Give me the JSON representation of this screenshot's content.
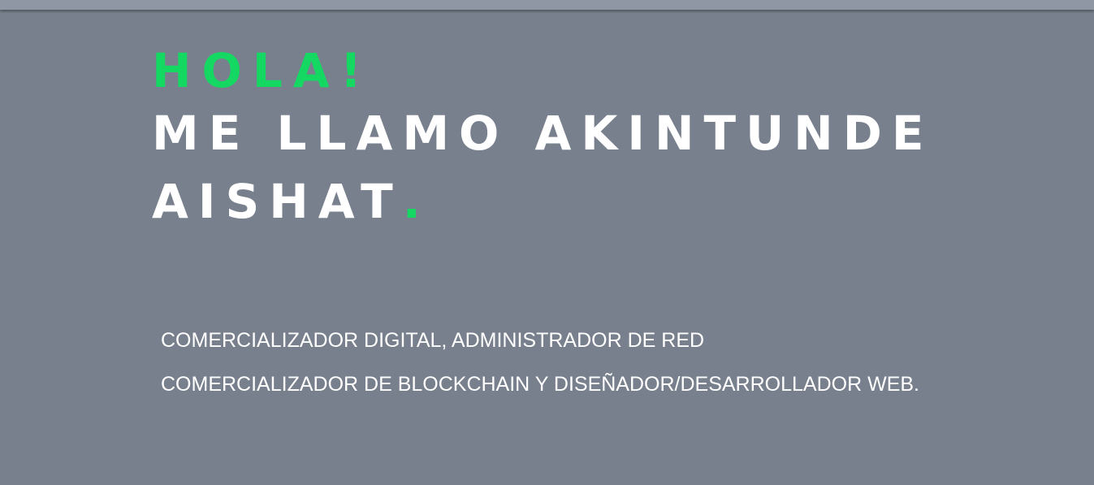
{
  "hero": {
    "greeting": "HOLA!",
    "name_line_1": "ME LLAMO AKINTUNDE",
    "name_line_2": "AISHAT",
    "name_punct": "."
  },
  "description": {
    "line_1": "COMERCIALIZADOR DIGITAL, ADMINISTRADOR DE RED",
    "line_2": "COMERCIALIZADOR DE BLOCKCHAIN Y DISEÑADOR/DESARROLLADOR WEB."
  },
  "colors": {
    "background": "#78808d",
    "accent": "#14d862",
    "text": "#ffffff"
  }
}
